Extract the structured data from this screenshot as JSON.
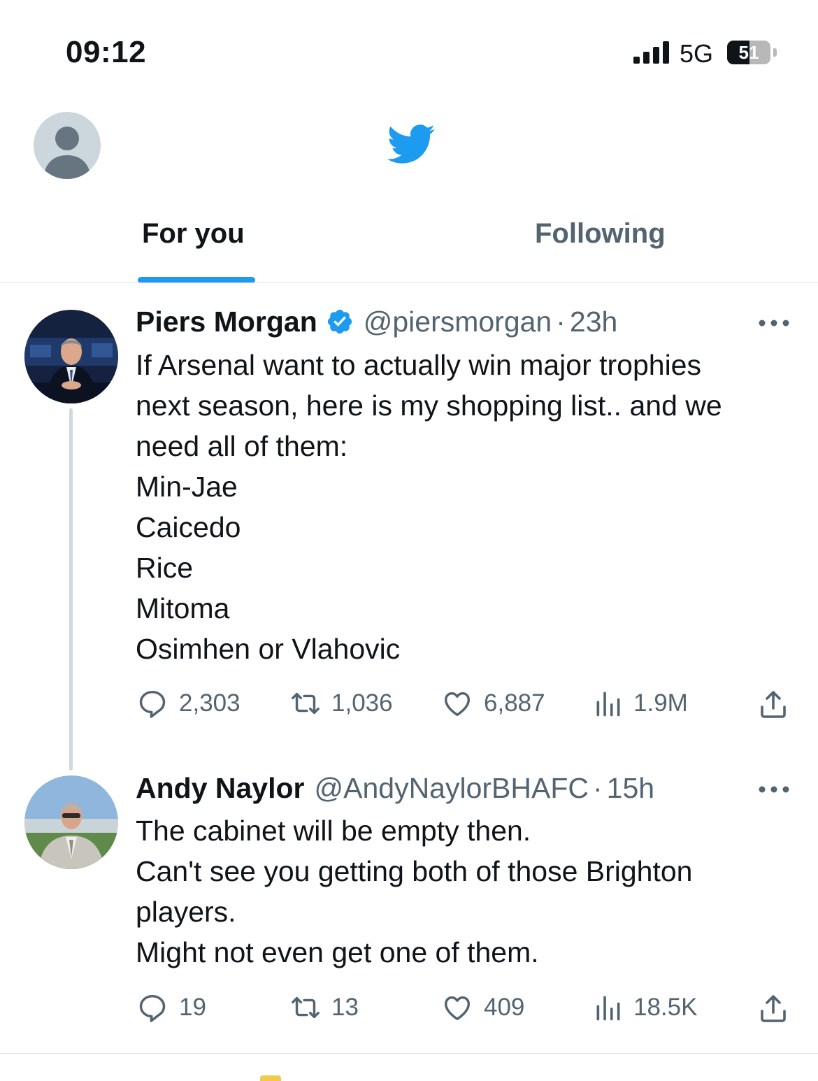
{
  "status_bar": {
    "time": "09:12",
    "network": "5G",
    "battery": "51",
    "battery_level_percent": 51
  },
  "header": {
    "logo_icon": "twitter-bird-icon",
    "avatar_icon": "default-profile-icon"
  },
  "tabs": [
    {
      "label": "For you",
      "active": true
    },
    {
      "label": "Following",
      "active": false
    }
  ],
  "colors": {
    "accent": "#1d9bf0",
    "text": "#0f1419",
    "secondary": "#536471",
    "divider": "#dfe3e6"
  },
  "tweets": [
    {
      "name": "Piers Morgan",
      "verified": true,
      "handle": "@piersmorgan",
      "dot": "·",
      "time": "23h",
      "lines": [
        "If Arsenal want to actually win major trophies",
        "next season, here is my shopping list.. and we",
        "need all of them:",
        "Min-Jae",
        "Caicedo",
        "Rice",
        "Mitoma",
        "Osimhen or Vlahovic"
      ],
      "replies": "2,303",
      "retweets": "1,036",
      "likes": "6,887",
      "views": "1.9M"
    },
    {
      "name": "Andy Naylor",
      "verified": false,
      "handle": "@AndyNaylorBHAFC",
      "dot": "·",
      "time": "15h",
      "lines": [
        "The cabinet will be empty then.",
        "Can't see you getting both of those Brighton",
        "players.",
        "Might not even get one of them."
      ],
      "replies": "19",
      "retweets": "13",
      "likes": "409",
      "views": "18.5K"
    }
  ]
}
